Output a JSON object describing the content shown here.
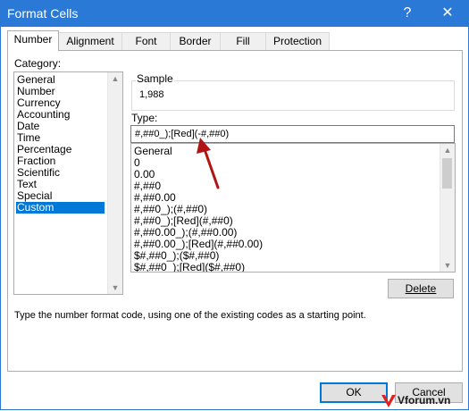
{
  "window": {
    "title": "Format Cells",
    "help_glyph": "?",
    "close_glyph": "✕"
  },
  "tabs": [
    {
      "label": "Number",
      "active": true
    },
    {
      "label": "Alignment",
      "active": false
    },
    {
      "label": "Font",
      "active": false
    },
    {
      "label": "Border",
      "active": false
    },
    {
      "label": "Fill",
      "active": false
    },
    {
      "label": "Protection",
      "active": false
    }
  ],
  "category": {
    "label": "Category:",
    "items": [
      "General",
      "Number",
      "Currency",
      "Accounting",
      "Date",
      "Time",
      "Percentage",
      "Fraction",
      "Scientific",
      "Text",
      "Special",
      "Custom"
    ],
    "selected": "Custom"
  },
  "sample": {
    "label": "Sample",
    "value": "1,988"
  },
  "type": {
    "label": "Type:",
    "value": "#,##0_);[Red](-#,##0)",
    "list": [
      "General",
      "0",
      "0.00",
      "#,##0",
      "#,##0.00",
      "#,##0_);(#,##0)",
      "#,##0_);[Red](#,##0)",
      "#,##0.00_);(#,##0.00)",
      "#,##0.00_);[Red](#,##0.00)",
      "$#,##0_);($#,##0)",
      "$#,##0_);[Red]($#,##0)"
    ]
  },
  "buttons": {
    "delete": "Delete",
    "ok": "OK",
    "cancel": "Cancel"
  },
  "hint": "Type the number format code, using one of the existing codes as a starting point.",
  "watermark": {
    "text": "Vforum.vn",
    "accent": "#e02020"
  },
  "colors": {
    "titlebar": "#2b79d6",
    "selection": "#0078d7",
    "arrow": "#b01515"
  }
}
